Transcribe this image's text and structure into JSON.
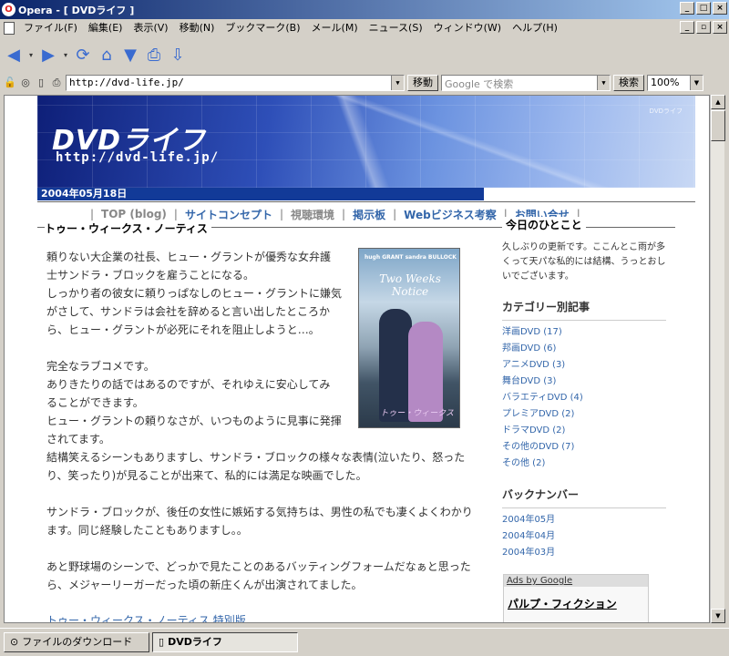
{
  "window": {
    "title": "Opera - [ DVDライフ ]"
  },
  "menu": [
    "ファイル(F)",
    "編集(E)",
    "表示(V)",
    "移動(N)",
    "ブックマーク(B)",
    "メール(M)",
    "ニュース(S)",
    "ウィンドウ(W)",
    "ヘルプ(H)"
  ],
  "address": {
    "url": "http://dvd-life.jp/",
    "go_label": "移動",
    "search_placeholder": "Google で検索",
    "search_label": "検索",
    "zoom": "100%"
  },
  "site": {
    "logo": "DVDライフ",
    "url_text": "http://dvd-life.jp/",
    "banner_tag": "DVDライフ",
    "date": "2004年05月18日",
    "nav": [
      {
        "label": "TOP (blog)",
        "style": "muted"
      },
      {
        "label": "サイトコンセプト",
        "style": "link"
      },
      {
        "label": "視聴環境",
        "style": "muted"
      },
      {
        "label": "掲示板",
        "style": "link"
      },
      {
        "label": "Webビジネス考察",
        "style": "link"
      },
      {
        "label": "お問い合せ",
        "style": "link"
      }
    ]
  },
  "post": {
    "title": "トゥー・ウィークス・ノーティス",
    "poster": {
      "names": "hugh GRANT  sandra BULLOCK",
      "title": "Two Weeks Notice",
      "jp": "トゥー・ウィークス"
    },
    "paragraphs": [
      [
        "頼りない大企業の社長、ヒュー・グラントが優秀な女弁護",
        "士サンドラ・ブロックを雇うことになる。",
        "しっかり者の彼女に頼りっぱなしのヒュー・グラントに嫌気",
        "がさして、サンドラは会社を辞めると言い出したところか",
        "ら、ヒュー・グラントが必死にそれを阻止しようと…。"
      ],
      [
        "完全なラブコメです。",
        "ありきたりの話ではあるのですが、それゆえに安心してみ",
        "ることができます。",
        "ヒュー・グラントの頼りなさが、いつものように見事に発揮",
        "されてます。",
        "結構笑えるシーンもありますし、サンドラ・ブロックの様々な表情(泣いたり、怒った",
        "り、笑ったり)が見ることが出来て、私的には満足な映画でした。"
      ],
      [
        "サンドラ・ブロックが、後任の女性に嫉妬する気持ちは、男性の私でも凄くよくわかり",
        "ます。同じ経験したこともありますし。。"
      ],
      [
        "あと野球場のシーンで、どっかで見たことのあるバッティングフォームだなぁと思った",
        "ら、メジャーリーガーだった頃の新庄くんが出演されてました。"
      ]
    ],
    "link": "トゥー・ウィークス・ノーティス 特別版"
  },
  "sidebar": {
    "today_title": "今日のひとこと",
    "today_text": "久しぶりの更新です。ここんとこ雨が多くって天パな私的には結構、うっとおしいでございます。",
    "categories_title": "カテゴリー別記事",
    "categories": [
      "洋画DVD (17)",
      "邦画DVD (6)",
      "アニメDVD (3)",
      "舞台DVD (3)",
      "バラエティDVD (4)",
      "プレミアDVD (2)",
      "ドラマDVD (2)",
      "その他のDVD (7)",
      "その他 (2)"
    ],
    "backnumber_title": "バックナンバー",
    "backnumbers": [
      "2004年05月",
      "2004年04月",
      "2004年03月"
    ],
    "ads_label": "Ads by Google",
    "ad_link": "パルプ・フィクション"
  },
  "taskbar": {
    "downloads": "ファイルのダウンロード",
    "active_tab": "DVDライフ"
  }
}
